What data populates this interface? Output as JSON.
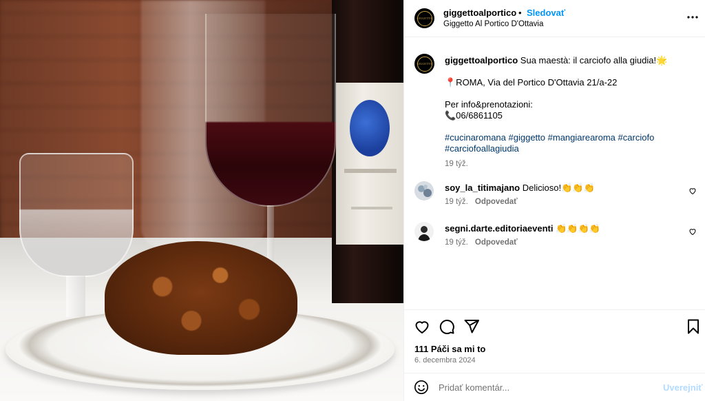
{
  "post": {
    "image_alt": "Fried artichoke on a white plate with wine and water glasses"
  },
  "header": {
    "username": "giggettoalportico",
    "separator": "•",
    "follow_label": "Sledovať",
    "location": "Giggetto Al Portico D'Ottavia",
    "avatar_text": "GIGGETTO",
    "more_icon": "more-horizontal-icon"
  },
  "caption": {
    "username": "giggettoalportico",
    "line1": "Sua maestà: il carciofo alla giudia!🌟",
    "line2": "📍ROMA, Via del Portico D'Ottavia 21/a-22",
    "line3": "Per info&prenotazioni:",
    "line4": "📞06/6861105",
    "hashtags": [
      "#cucinaromana",
      "#giggetto",
      "#mangiarearoma",
      "#carciofo",
      "#carciofoallagiudia"
    ],
    "time": "19 týž."
  },
  "comments": [
    {
      "username": "soy_la_titimajano",
      "text": "Delicioso!👏👏👏",
      "time": "19 týž.",
      "reply_label": "Odpovedať"
    },
    {
      "username": "segni.darte.editoriaeventi",
      "text": "👏👏👏👏",
      "time": "19 týž.",
      "reply_label": "Odpovedať"
    }
  ],
  "actions": {
    "likes": "111 Páči sa mi to",
    "date": "6. decembra 2024"
  },
  "add_comment": {
    "placeholder": "Pridať komentár...",
    "post_label": "Uverejniť"
  },
  "colors": {
    "accent": "#0095f6",
    "hashtag": "#00376b",
    "muted": "#737373",
    "post_disabled": "#b3dbff"
  }
}
